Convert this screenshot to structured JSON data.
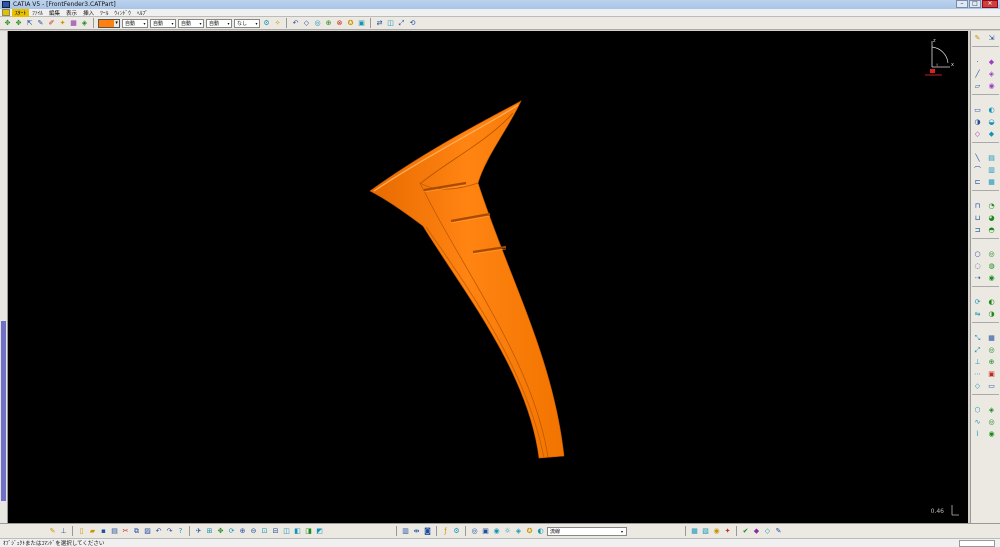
{
  "window": {
    "title": "CATIA V5 - [FrontFender3.CATPart]",
    "minimize": "–",
    "maximize": "□",
    "close": "✕"
  },
  "menu": {
    "items": [
      "ｽﾀｰﾄ",
      "ﾌｧｲﾙ",
      "編集",
      "表示",
      "挿入",
      "ﾂｰﾙ",
      "ｳｨﾝﾄﾞｳ",
      "ﾍﾙﾌﾟ"
    ]
  },
  "toolbar": {
    "color": "#ff7f0f",
    "combos": [
      "自動",
      "自動",
      "自動",
      "自動",
      "なし"
    ]
  },
  "viewport": {
    "background": "#000000",
    "part_color": "#ff7f0f",
    "compass": {
      "z_label": "z",
      "x_label": "x",
      "y_label": "y"
    },
    "zoom_value": "0.46"
  },
  "bottom_toolbar": {
    "render_combo": "流線"
  },
  "status": {
    "prompt": "ｵﾌﾞｼﾞｪｸﾄまたはｺﾏﾝﾄﾞを選択してください"
  }
}
